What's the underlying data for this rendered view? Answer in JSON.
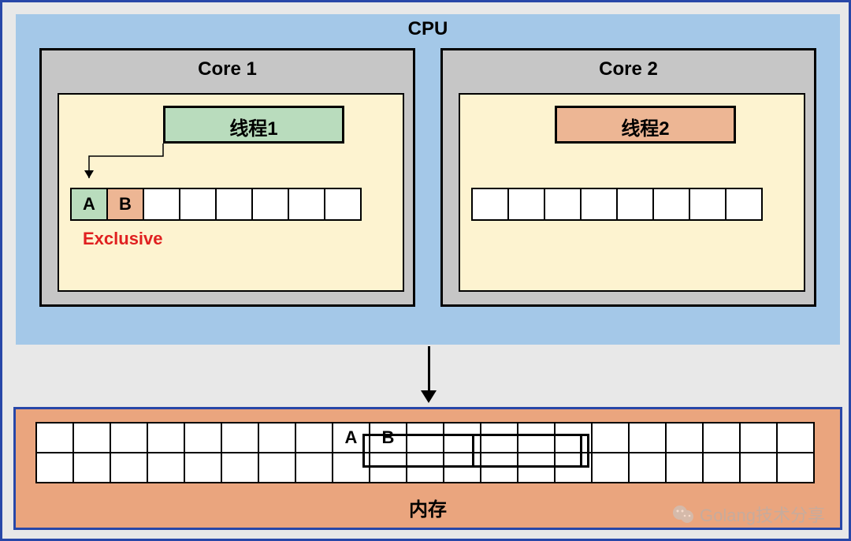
{
  "cpu": {
    "title": "CPU",
    "cores": [
      {
        "title": "Core 1",
        "thread_label": "线程1",
        "thread_color": "green",
        "cache": [
          {
            "label": "A",
            "type": "a"
          },
          {
            "label": "B",
            "type": "b"
          },
          {
            "label": "",
            "type": ""
          },
          {
            "label": "",
            "type": ""
          },
          {
            "label": "",
            "type": ""
          },
          {
            "label": "",
            "type": ""
          },
          {
            "label": "",
            "type": ""
          },
          {
            "label": "",
            "type": ""
          }
        ],
        "status_label": "Exclusive",
        "has_arrow": true
      },
      {
        "title": "Core 2",
        "thread_label": "线程2",
        "thread_color": "orange",
        "cache": [
          {
            "label": "",
            "type": ""
          },
          {
            "label": "",
            "type": ""
          },
          {
            "label": "",
            "type": ""
          },
          {
            "label": "",
            "type": ""
          },
          {
            "label": "",
            "type": ""
          },
          {
            "label": "",
            "type": ""
          },
          {
            "label": "",
            "type": ""
          },
          {
            "label": "",
            "type": ""
          }
        ],
        "status_label": "",
        "has_arrow": false
      }
    ]
  },
  "memory": {
    "title": "内存",
    "cols": 21,
    "rows": 2,
    "cells_row1": [
      "",
      "",
      "",
      "",
      "",
      "",
      "",
      "",
      "A",
      "B",
      "",
      "",
      "",
      "",
      "",
      "",
      "",
      "",
      "",
      "",
      ""
    ],
    "cell_types_row1": [
      "",
      "",
      "",
      "",
      "",
      "",
      "",
      "",
      "a",
      "b",
      "",
      "",
      "",
      "",
      "",
      "",
      "",
      "",
      "",
      "",
      ""
    ]
  },
  "watermark": "Golang技术分享"
}
